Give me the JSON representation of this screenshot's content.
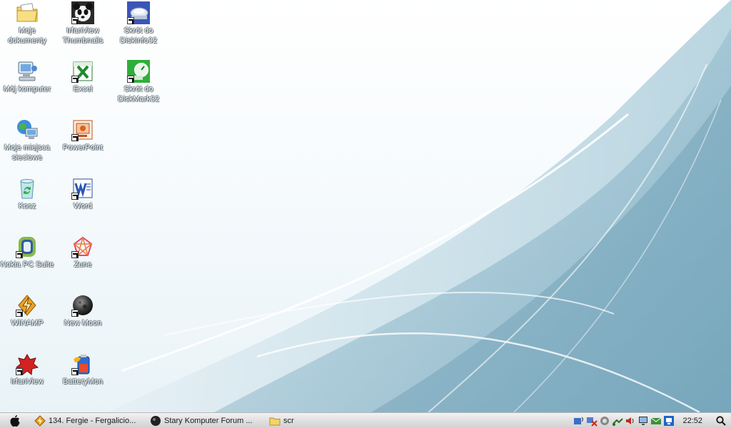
{
  "desktop": {
    "icons": [
      {
        "label": "Moje dokumenty"
      },
      {
        "label": "IrfanView Thumbnails"
      },
      {
        "label": "Skrót do DiskInfo32"
      },
      {
        "label": "Mój komputer"
      },
      {
        "label": "Excel"
      },
      {
        "label": "Skrót do DiskMark32"
      },
      {
        "label": "Moje miejsca sieciowe"
      },
      {
        "label": "PowerPoint"
      },
      {
        "label": "Kosz"
      },
      {
        "label": "Word"
      },
      {
        "label": "Nokia PC Suite"
      },
      {
        "label": "Zune"
      },
      {
        "label": "WINAMP"
      },
      {
        "label": "New Moon"
      },
      {
        "label": "IrfanView"
      },
      {
        "label": "BatteryMon"
      }
    ]
  },
  "taskbar": {
    "tasks": [
      {
        "label": "134. Fergie - Fergalicio..."
      },
      {
        "label": "Stary Komputer Forum ..."
      },
      {
        "label": "scr"
      }
    ],
    "clock": "22:52"
  },
  "colors": {
    "wallpaper_accent": "#7fb3c9",
    "wallpaper_light": "#e6f1f6",
    "taskbar": "#dcdcdc"
  }
}
